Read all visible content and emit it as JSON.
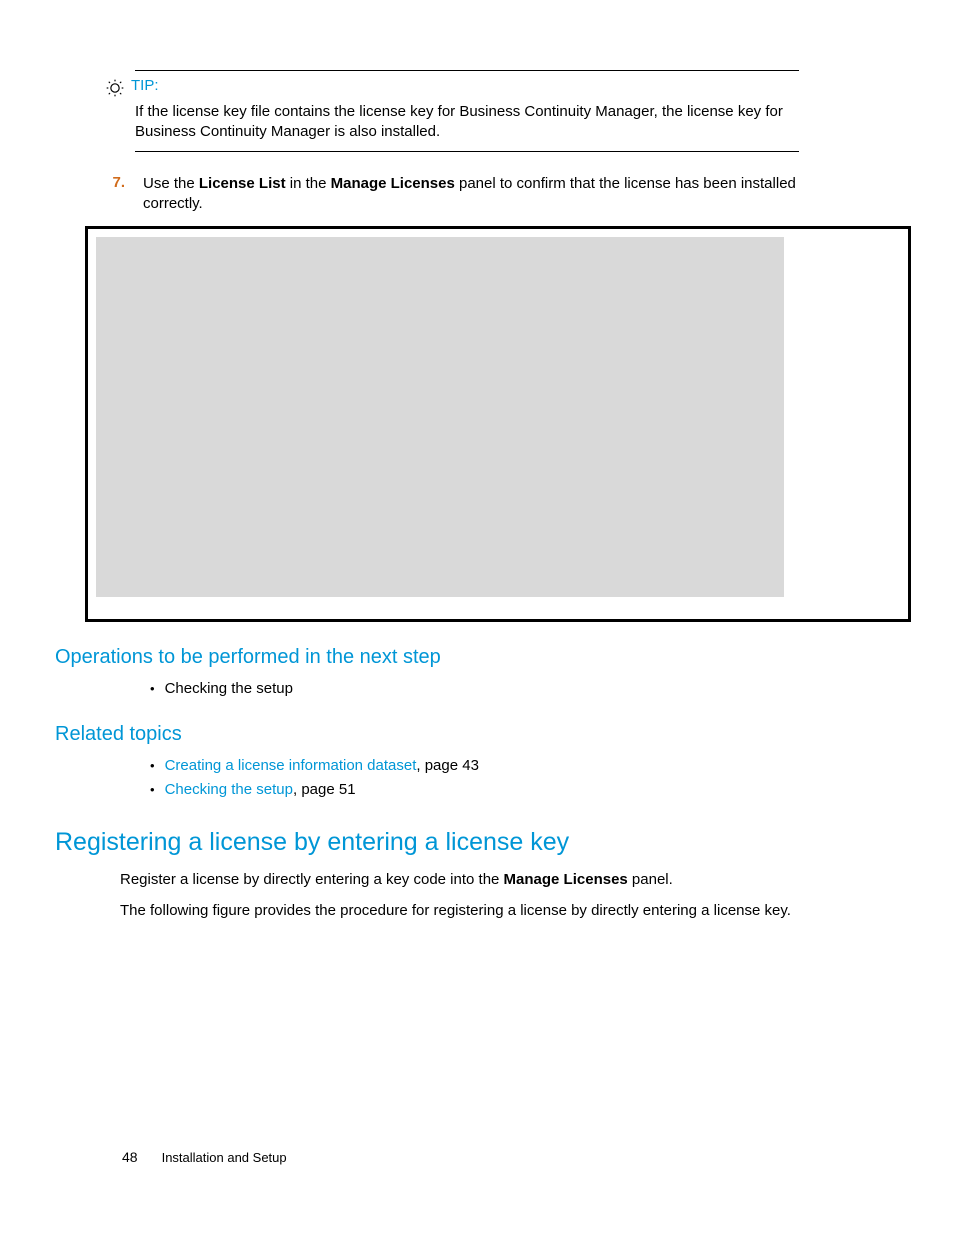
{
  "tip": {
    "label": "TIP:",
    "body": "If the license key file contains the license key for Business Continuity Manager, the license key for Business Continuity Manager is also installed."
  },
  "step7": {
    "number": "7.",
    "pre": "Use the ",
    "b1": "License List",
    "mid": " in the ",
    "b2": "Manage Licenses",
    "post": " panel to confirm that the license has been installed correctly."
  },
  "sections": {
    "nextOps": {
      "heading": "Operations to be performed in the next step",
      "items": [
        {
          "text": "Checking the setup"
        }
      ]
    },
    "related": {
      "heading": "Related topics",
      "items": [
        {
          "link": "Creating a license information dataset",
          "rest": ", page 43"
        },
        {
          "link": "Checking the setup",
          "rest": ", page 51"
        }
      ]
    },
    "register": {
      "heading": "Registering a license by entering a license key",
      "p1_pre": "Register a license by directly entering a key code into the ",
      "p1_bold": "Manage Licenses",
      "p1_post": " panel.",
      "p2": "The following figure provides the procedure for registering a license by directly entering a license key."
    }
  },
  "footer": {
    "page": "48",
    "section": "Installation and Setup"
  }
}
